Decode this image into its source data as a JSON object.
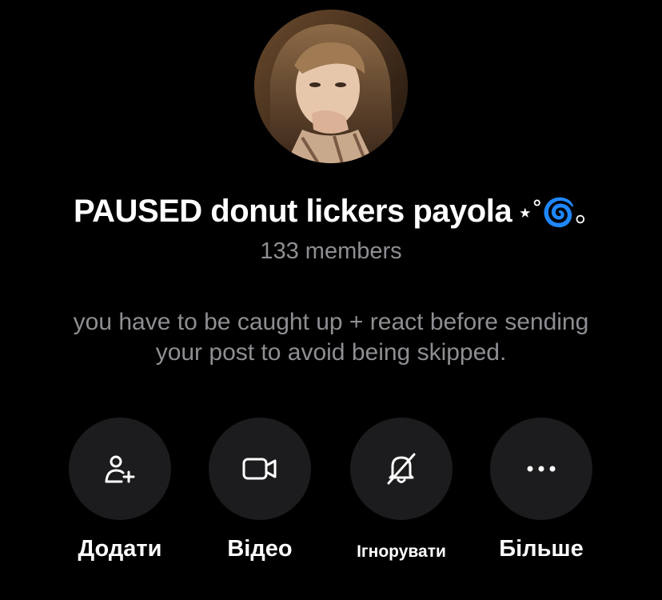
{
  "group": {
    "name": "PAUSED donut lickers payola",
    "name_decoration": "⋆˚🌀｡",
    "members": "133 members",
    "description": "you have to be caught up + react before sending your post to avoid being skipped."
  },
  "actions": [
    {
      "id": "add",
      "label": "Додати",
      "icon": "add-member-icon"
    },
    {
      "id": "video",
      "label": "Відео",
      "icon": "video-camera-icon"
    },
    {
      "id": "mute",
      "label": "Ігнорувати",
      "icon": "bell-slash-icon"
    },
    {
      "id": "more",
      "label": "Більше",
      "icon": "ellipsis-icon"
    }
  ],
  "colors": {
    "background": "#000000",
    "button_background": "#1c1c1e",
    "secondary_text": "#8e8e93",
    "primary_text": "#ffffff"
  }
}
